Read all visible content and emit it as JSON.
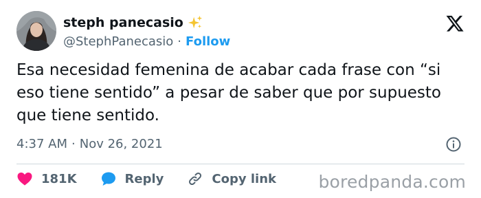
{
  "author": {
    "display_name": "steph panecasio",
    "handle": "@StephPanecasio",
    "separator": "·",
    "follow_label": "Follow",
    "badge_icon": "sparkles-icon"
  },
  "tweet": {
    "text": "Esa necesidad femenina de acabar cada frase con “si eso tiene sentido” a pesar de saber que por supuesto que tiene sentido.",
    "time": "4:37 AM",
    "date_separator": "·",
    "date": "Nov 26, 2021"
  },
  "actions": {
    "likes_count": "181K",
    "reply_label": "Reply",
    "copy_link_label": "Copy link"
  },
  "watermark": "boredpanda.com",
  "colors": {
    "accent": "#1d9bf0",
    "like": "#f91880",
    "text": "#0f1419",
    "muted": "#536471"
  }
}
